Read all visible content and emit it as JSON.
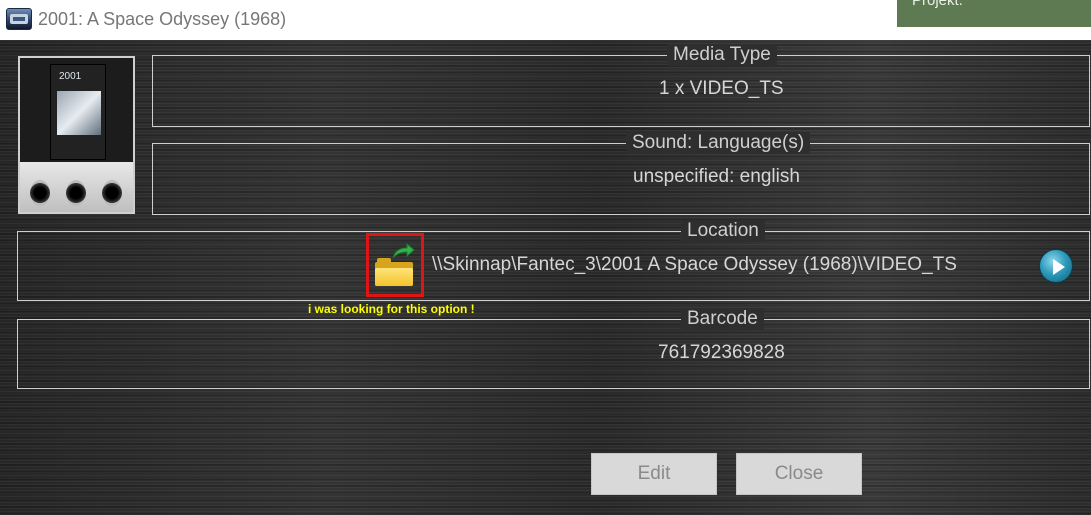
{
  "window": {
    "title": "2001: A Space Odyssey (1968)",
    "app_icon": "app-logo-icon"
  },
  "toast": {
    "text": "Projekt."
  },
  "poster": {
    "box_text": "2001"
  },
  "media_type": {
    "legend": "Media Type",
    "value": "1 x VIDEO_TS"
  },
  "sound": {
    "legend": "Sound: Language(s)",
    "value": "unspecified: english"
  },
  "location": {
    "legend": "Location",
    "path": "\\\\Skinnap\\Fantec_3\\2001 A Space Odyssey (1968)\\VIDEO_TS",
    "folder_icon": "open-folder-icon",
    "play_icon": "play-icon"
  },
  "annotation": {
    "text": "i was looking for this option !",
    "color": "#ffff00",
    "highlight_color": "#e01414"
  },
  "barcode": {
    "legend": "Barcode",
    "value": "761792369828"
  },
  "buttons": {
    "edit": "Edit",
    "close": "Close"
  }
}
